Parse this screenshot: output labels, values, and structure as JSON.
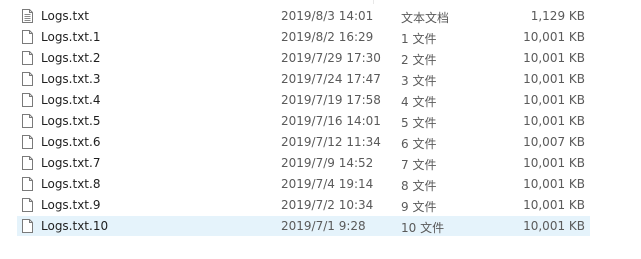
{
  "files": [
    {
      "name": "Logs.txt",
      "date": "2019/8/3 14:01",
      "type": "文本文档",
      "size": "1,129 KB",
      "icon": "text-document-icon"
    },
    {
      "name": "Logs.txt.1",
      "date": "2019/8/2 16:29",
      "type": "1 文件",
      "size": "10,001 KB",
      "icon": "blank-file-icon"
    },
    {
      "name": "Logs.txt.2",
      "date": "2019/7/29 17:30",
      "type": "2 文件",
      "size": "10,001 KB",
      "icon": "blank-file-icon"
    },
    {
      "name": "Logs.txt.3",
      "date": "2019/7/24 17:47",
      "type": "3 文件",
      "size": "10,001 KB",
      "icon": "blank-file-icon"
    },
    {
      "name": "Logs.txt.4",
      "date": "2019/7/19 17:58",
      "type": "4 文件",
      "size": "10,001 KB",
      "icon": "blank-file-icon"
    },
    {
      "name": "Logs.txt.5",
      "date": "2019/7/16 14:01",
      "type": "5 文件",
      "size": "10,001 KB",
      "icon": "blank-file-icon"
    },
    {
      "name": "Logs.txt.6",
      "date": "2019/7/12 11:34",
      "type": "6 文件",
      "size": "10,007 KB",
      "icon": "blank-file-icon"
    },
    {
      "name": "Logs.txt.7",
      "date": "2019/7/9 14:52",
      "type": "7 文件",
      "size": "10,001 KB",
      "icon": "blank-file-icon"
    },
    {
      "name": "Logs.txt.8",
      "date": "2019/7/4 19:14",
      "type": "8 文件",
      "size": "10,001 KB",
      "icon": "blank-file-icon"
    },
    {
      "name": "Logs.txt.9",
      "date": "2019/7/2 10:34",
      "type": "9 文件",
      "size": "10,001 KB",
      "icon": "blank-file-icon"
    },
    {
      "name": "Logs.txt.10",
      "date": "2019/7/1 9:28",
      "type": "10 文件",
      "size": "10,001 KB",
      "icon": "blank-file-icon"
    }
  ],
  "selected_index": 10,
  "colors": {
    "selection": "#e5f3fb",
    "text": "#1f1f1f",
    "secondary_text": "#5a5a5a"
  }
}
